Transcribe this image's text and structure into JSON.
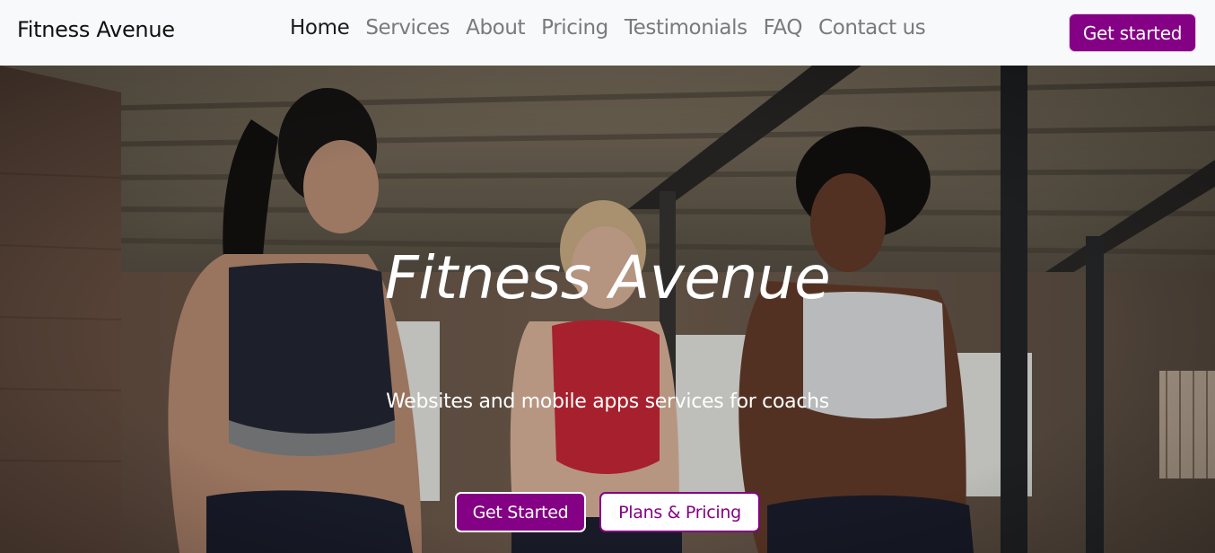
{
  "navbar": {
    "brand": "Fitness Avenue",
    "links": [
      {
        "label": "Home"
      },
      {
        "label": "Services"
      },
      {
        "label": "About"
      },
      {
        "label": "Pricing"
      },
      {
        "label": "Testimonials"
      },
      {
        "label": "FAQ"
      },
      {
        "label": "Contact us"
      }
    ],
    "active_link": "Home",
    "cta_label": "Get started"
  },
  "hero": {
    "title": "Fitness Avenue",
    "subtitle": "Websites and mobile apps services for coachs",
    "primary_button": "Get Started",
    "secondary_button": "Plans & Pricing",
    "background_image": "three women laughing in a gym with brick walls and wooden ceiling"
  },
  "colors": {
    "brand_purple": "#840084",
    "navbar_bg": "#f8f9fa",
    "nav_link": "#7a7a7a",
    "nav_link_active": "#1b1b1b"
  }
}
